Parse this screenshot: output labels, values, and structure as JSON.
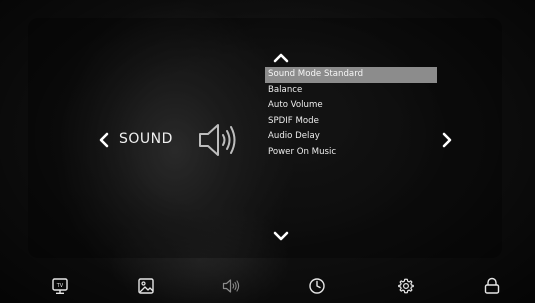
{
  "menu": {
    "section_title": "SOUND",
    "items": [
      {
        "label": "Sound Mode Standard",
        "selected": true
      },
      {
        "label": "Balance",
        "selected": false
      },
      {
        "label": "Auto Volume",
        "selected": false
      },
      {
        "label": "SPDIF Mode",
        "selected": false
      },
      {
        "label": "Audio Delay",
        "selected": false
      },
      {
        "label": "Power On Music",
        "selected": false
      }
    ]
  },
  "icons": {
    "nav": [
      "chevron-up-icon",
      "chevron-down-icon",
      "chevron-left-icon",
      "chevron-right-icon"
    ],
    "section": "speaker-icon",
    "tabs": [
      "tv-icon",
      "picture-icon",
      "sound-icon",
      "clock-icon",
      "gear-icon",
      "lock-icon"
    ],
    "active_tab": "sound-icon"
  },
  "colors": {
    "highlight": "#8c8c8c",
    "text": "#e8e8e8",
    "inactive_tab": "#8a8a8a"
  }
}
